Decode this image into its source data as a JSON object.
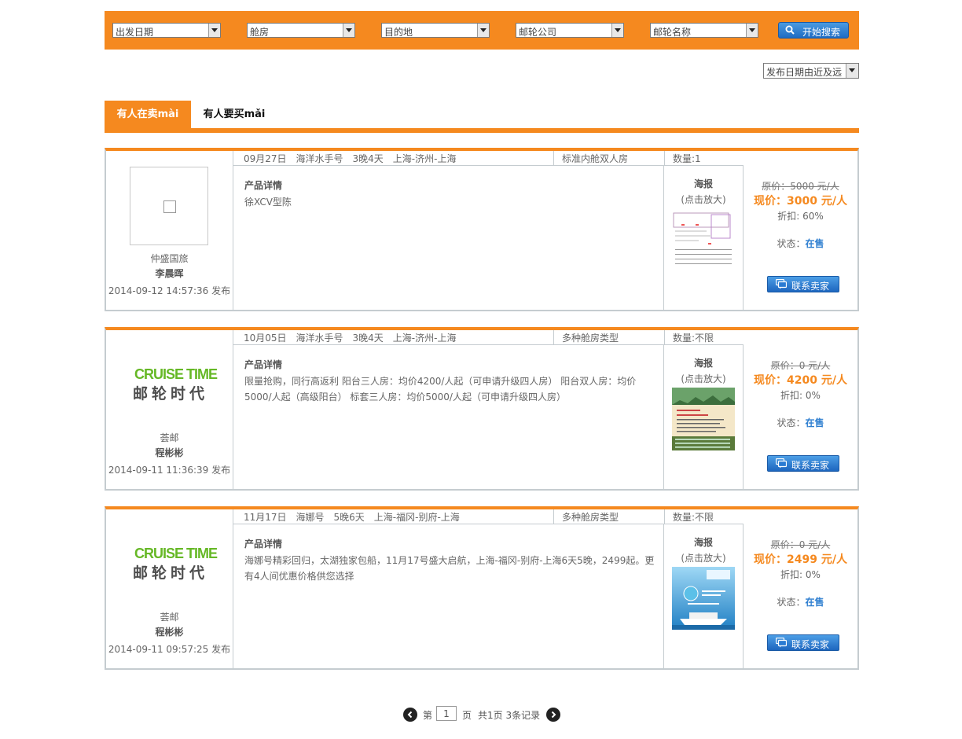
{
  "search": {
    "filters": [
      {
        "label": "出发日期"
      },
      {
        "label": "舱房"
      },
      {
        "label": "目的地"
      },
      {
        "label": "邮轮公司"
      },
      {
        "label": "邮轮名称"
      }
    ],
    "button_label": "开始搜索",
    "sort_label": "发布日期由近及远"
  },
  "tabs": {
    "active": "有人在卖mài",
    "inactive": "有人要买mǎi"
  },
  "listings": [
    {
      "route": "09月27日　海洋水手号　3晚4天　上海-济州-上海",
      "cabin": "标准内舱双人房",
      "qty": "数量:1",
      "detail_title": "产品详情",
      "detail_body": "徐XCV型陈",
      "poster_title": "海报",
      "poster_sub": "(点击放大)",
      "agency": "仲盛国旅",
      "seller": "李晨晖",
      "published": "2014-09-12 14:57:36 发布",
      "orig_price": "原价：5000 元/人",
      "now_price": "现价：3000 元/人",
      "discount": "折扣: 60%",
      "status_label": "状态：",
      "status_value": "在售",
      "contact_label": "联系卖家"
    },
    {
      "route": "10月05日　海洋水手号　3晚4天　上海-济州-上海",
      "cabin": "多种舱房类型",
      "qty": "数量:不限",
      "detail_title": "产品详情",
      "detail_body": "限量抢购，同行高返利 阳台三人房：均价4200/人起（可申请升级四人房） 阳台双人房：均价5000/人起（高级阳台） 标套三人房：均价5000/人起（可申请升级四人房）",
      "poster_title": "海报",
      "poster_sub": "(点击放大)",
      "logo_en": "CRUISE TIME",
      "logo_cn": "邮轮时代",
      "agency": "荟邮",
      "seller": "程彬彬",
      "published": "2014-09-11 11:36:39 发布",
      "orig_price": "原价：0 元/人",
      "now_price": "现价：4200 元/人",
      "discount": "折扣: 0%",
      "status_label": "状态：",
      "status_value": "在售",
      "contact_label": "联系卖家"
    },
    {
      "route": "11月17日　海娜号　5晚6天　上海-福冈-别府-上海",
      "cabin": "多种舱房类型",
      "qty": "数量:不限",
      "detail_title": "产品详情",
      "detail_body": "海娜号精彩回归，太湖独家包船，11月17号盛大启航，上海-福冈-别府-上海6天5晚，2499起。更有4人间优惠价格供您选择",
      "poster_title": "海报",
      "poster_sub": "(点击放大)",
      "logo_en": "CRUISE TIME",
      "logo_cn": "邮轮时代",
      "agency": "荟邮",
      "seller": "程彬彬",
      "published": "2014-09-11 09:57:25 发布",
      "orig_price": "原价：0 元/人",
      "now_price": "现价：2499 元/人",
      "discount": "折扣: 0%",
      "status_label": "状态：",
      "status_value": "在售",
      "contact_label": "联系卖家"
    }
  ],
  "pager": {
    "prefix": "第",
    "current": "1",
    "suffix": "页",
    "summary": "共1页 3条记录"
  },
  "colors": {
    "accent": "#f5891f",
    "button_blue": "#1f6cc4",
    "status_blue": "#2f7fd0",
    "border": "#c5ccd0"
  }
}
